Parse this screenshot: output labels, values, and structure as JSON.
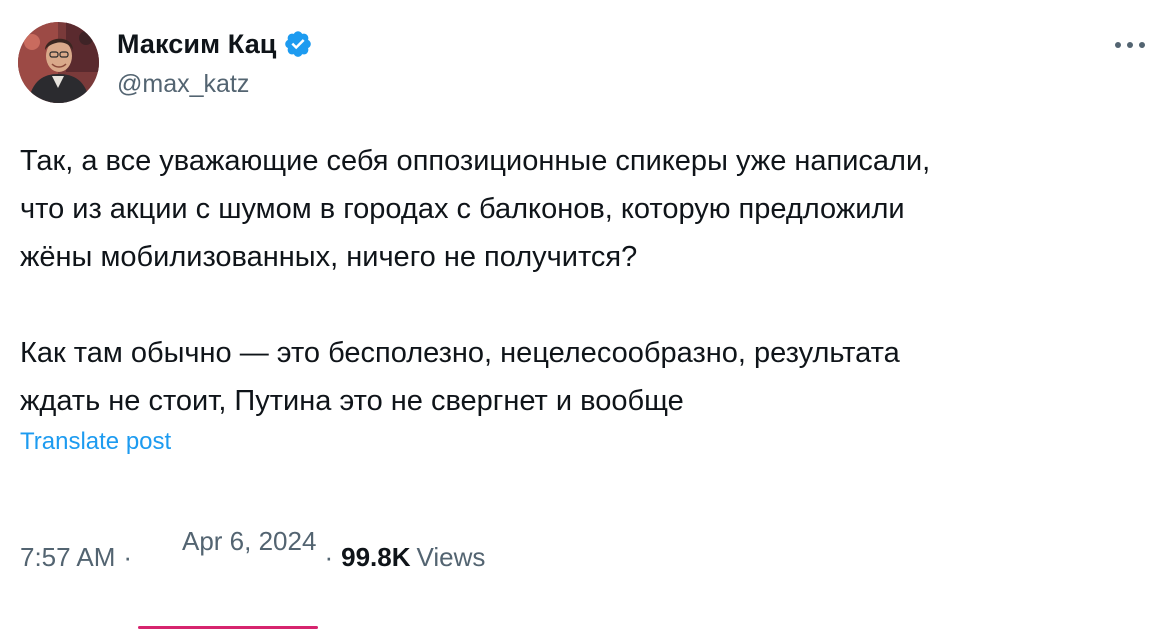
{
  "author": {
    "display_name": "Максим Кац",
    "handle": "@max_katz",
    "verified": true,
    "avatar_icon": "user-avatar-photo"
  },
  "tweet": {
    "paragraphs": [
      [
        "Так, а все уважающие себя оппозиционные спикеры уже написали,",
        "что из акции с шумом в городах с балконов, которую предложили",
        "жёны мобилизованных, ничего не получится?"
      ],
      [
        "Как там обычно — это бесполезно, нецелесообразно, результата",
        "ждать не стоит, Путина это не свергнет и вообще"
      ]
    ],
    "translate_label": "Translate post"
  },
  "meta": {
    "time": "7:57 AM",
    "separator": "·",
    "date": "Apr 6, 2024",
    "views_count": "99.8K",
    "views_label": "Views"
  },
  "colors": {
    "text": "#0f1419",
    "secondary": "#536471",
    "link": "#1d9bf0",
    "verified": "#1d9bf0",
    "date_underline": "#d6246e"
  },
  "icons": {
    "more": "more-horizontal-icon",
    "verified": "verified-badge-icon"
  }
}
